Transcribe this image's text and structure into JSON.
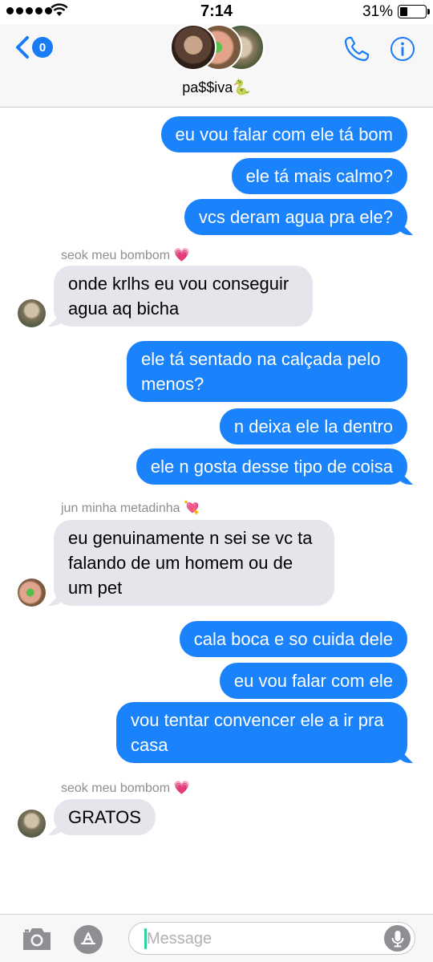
{
  "status_bar": {
    "time": "7:14",
    "battery_percent": "31%",
    "battery_level": 0.31,
    "signal_bars": 5
  },
  "header": {
    "unread_count": "0",
    "group_name": "pa$$iva🐍",
    "accent_color": "#1a7cf5",
    "icons": [
      "back-chevron-icon",
      "phone-icon",
      "info-icon"
    ]
  },
  "messages": [
    {
      "direction": "out",
      "text": "eu vou falar com ele tá bom"
    },
    {
      "direction": "out",
      "text": "ele tá mais calmo?"
    },
    {
      "direction": "out",
      "text": "vcs deram agua pra ele?"
    },
    {
      "direction": "sender",
      "text": "seok meu bombom 💗"
    },
    {
      "direction": "in",
      "text": "onde krlhs eu vou conseguir agua aq bicha"
    },
    {
      "direction": "out",
      "text": "ele tá sentado na calçada pelo menos?"
    },
    {
      "direction": "out",
      "text": "n deixa ele la dentro"
    },
    {
      "direction": "out",
      "text": "ele n gosta desse tipo de coisa"
    },
    {
      "direction": "sender",
      "text": "jun minha metadinha 💘"
    },
    {
      "direction": "in",
      "text": "eu genuinamente n sei se vc ta falando de um homem ou de um pet"
    },
    {
      "direction": "out",
      "text": "cala boca e so cuida dele"
    },
    {
      "direction": "out",
      "text": "eu vou falar com ele"
    },
    {
      "direction": "out",
      "text": "vou tentar convencer ele a ir pra casa"
    },
    {
      "direction": "sender",
      "text": "seok meu bombom 💗"
    },
    {
      "direction": "in",
      "text": "GRATOS"
    }
  ],
  "colors": {
    "outgoing_bubble": "#1a82fb",
    "incoming_bubble": "#e6e5eb",
    "sender_label": "#8e8e93"
  },
  "input": {
    "placeholder": "Message",
    "value": "",
    "icons": [
      "camera-icon",
      "app-store-icon",
      "microphone-icon"
    ]
  }
}
